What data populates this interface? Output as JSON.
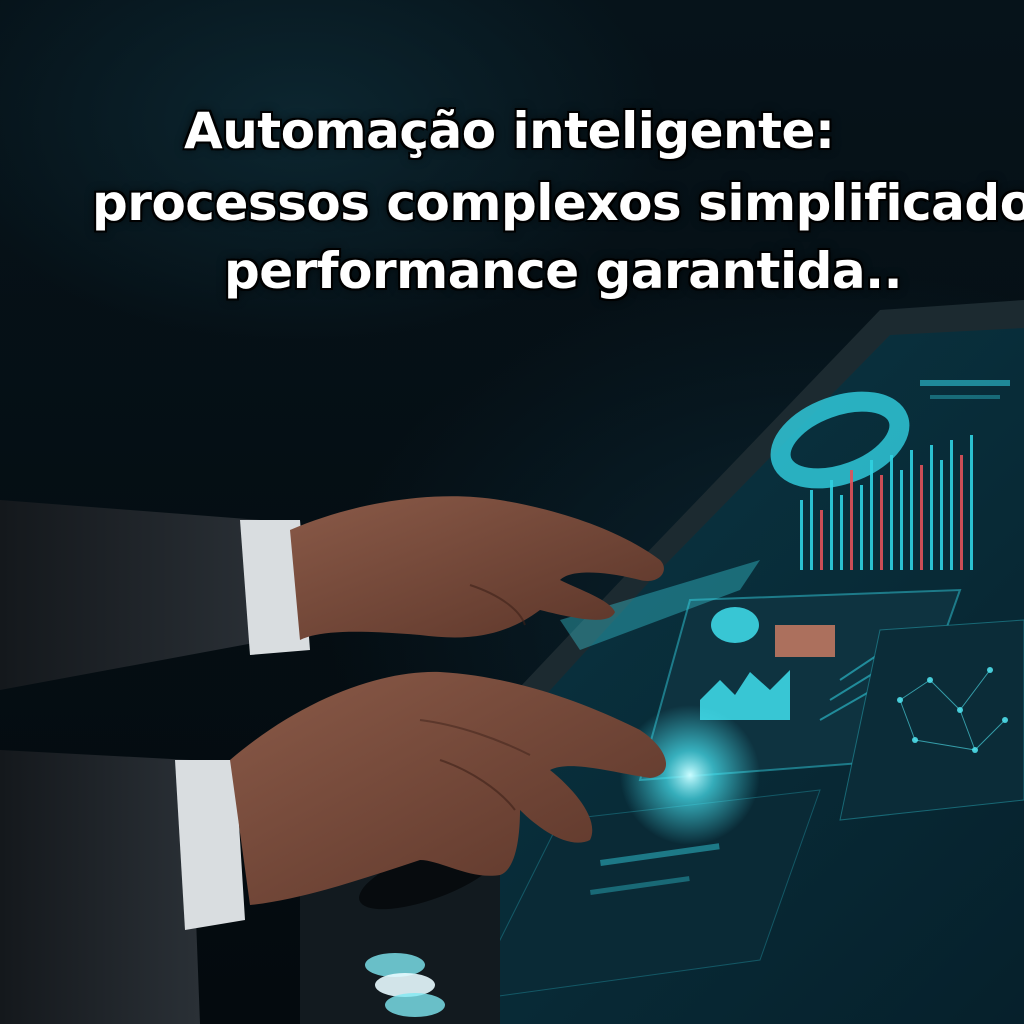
{
  "headline": {
    "line1": "Automação inteligente:",
    "line2": "processos complexos simplificados,",
    "line3": "performance garantida.."
  },
  "colors": {
    "background": "#050b10",
    "screen_glow": "#37d6e6",
    "accent_red": "#e0525a",
    "text": "#ffffff"
  },
  "scene": {
    "subject": "hands-touching-holographic-dashboard",
    "icons": [
      "hand",
      "touchscreen-dashboard",
      "control-buttons"
    ]
  }
}
